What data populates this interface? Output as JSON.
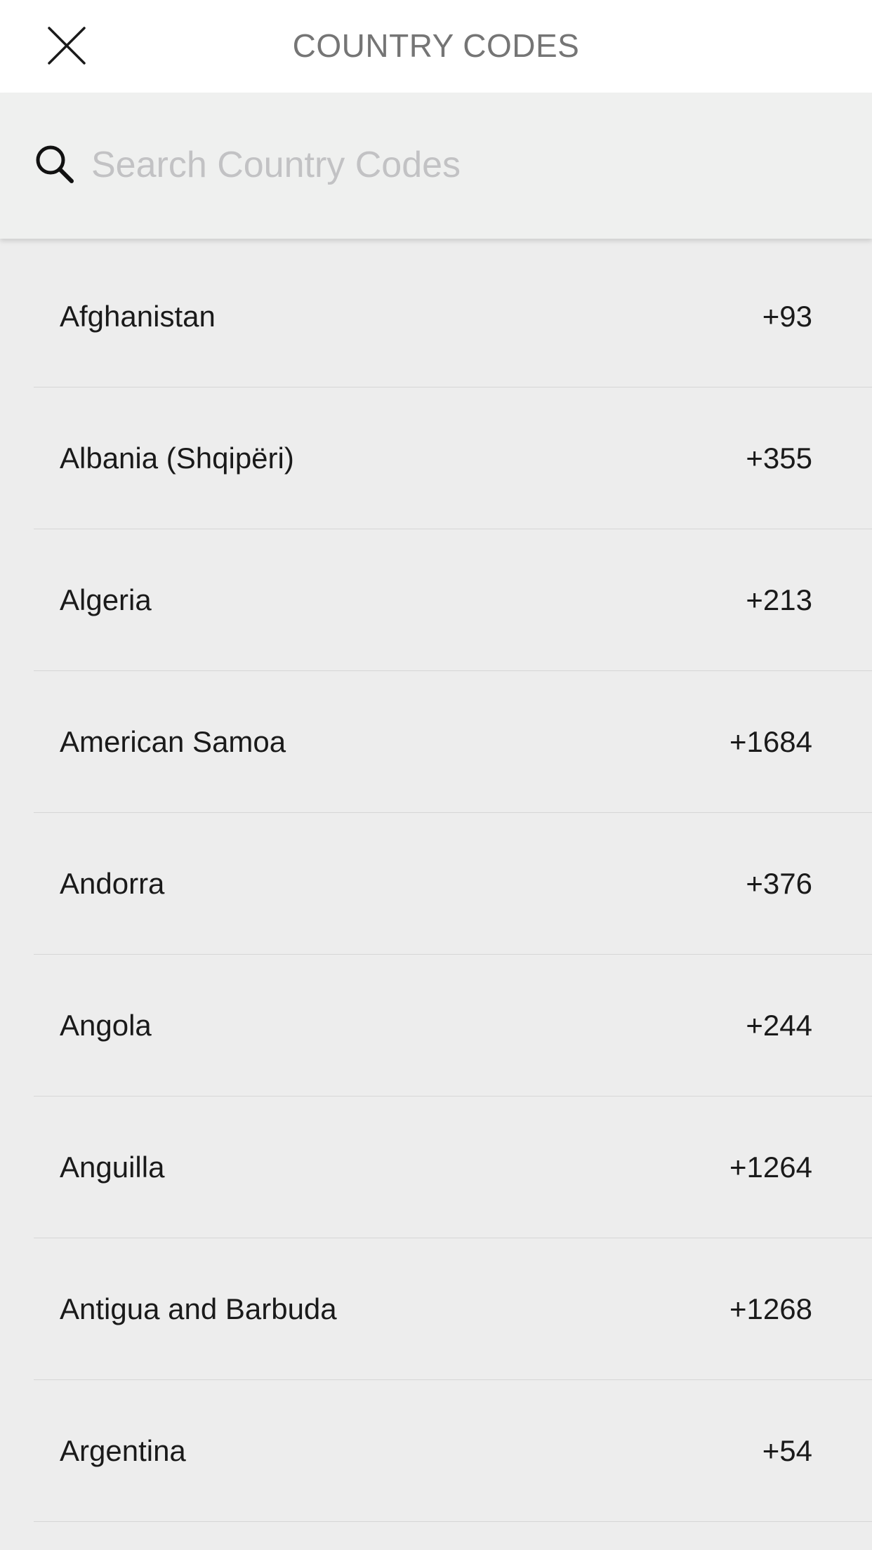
{
  "header": {
    "title": "COUNTRY CODES",
    "close_icon": "close-icon"
  },
  "search": {
    "icon": "search-icon",
    "placeholder": "Search Country Codes",
    "value": ""
  },
  "countries": [
    {
      "name": "Afghanistan",
      "code": "+93"
    },
    {
      "name": "Albania (Shqipëri)",
      "code": "+355"
    },
    {
      "name": "Algeria",
      "code": "+213"
    },
    {
      "name": "American Samoa",
      "code": "+1684"
    },
    {
      "name": "Andorra",
      "code": "+376"
    },
    {
      "name": "Angola",
      "code": "+244"
    },
    {
      "name": "Anguilla",
      "code": "+1264"
    },
    {
      "name": "Antigua and Barbuda",
      "code": "+1268"
    },
    {
      "name": "Argentina",
      "code": "+54"
    }
  ],
  "colors": {
    "header_bg": "#ffffff",
    "title": "#757575",
    "search_bg": "#eff0ef",
    "placeholder": "#c2c2c4",
    "list_bg": "#ededed",
    "divider": "#d6d6d6",
    "text": "#1a1a1a"
  }
}
